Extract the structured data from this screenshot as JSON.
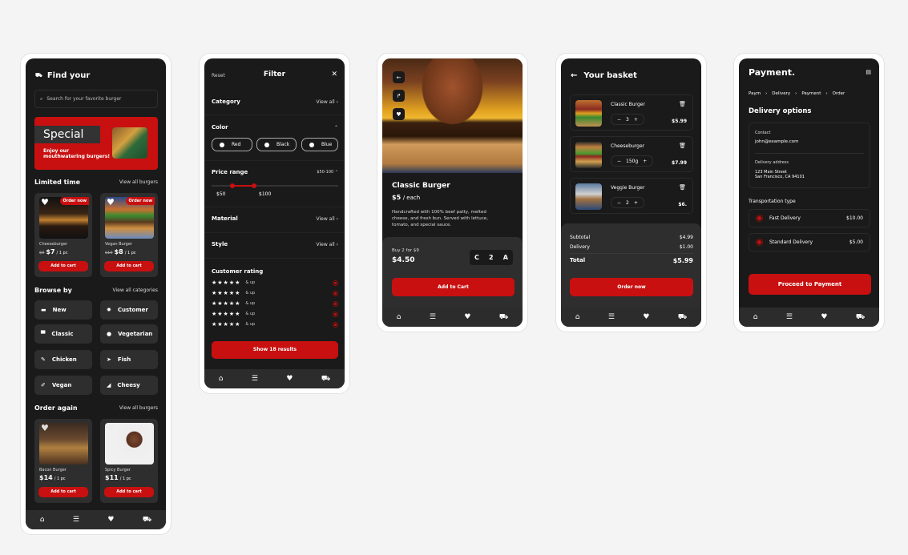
{
  "colors": {
    "accent": "#c81010",
    "background": "#1a1a1a",
    "surface": "#2e2e2e"
  },
  "nav": {
    "items": [
      {
        "name": "home",
        "icon": "⌂"
      },
      {
        "name": "list",
        "icon": "☰"
      },
      {
        "name": "favorites",
        "icon": "♥"
      },
      {
        "name": "basket",
        "icon": "🧺"
      }
    ]
  },
  "home": {
    "title": "Find your",
    "title_icon": "basket-icon",
    "search_placeholder": "Search for your favorite burger",
    "special": {
      "label": "Special",
      "subtitle": "Enjoy our mouthwatering burgers!"
    },
    "limited": {
      "title": "Limited time",
      "link": "View all burgers",
      "items": [
        {
          "name": "Cheeseburger",
          "old_price": "$9",
          "price": "$7",
          "unit": "/ 1 pc",
          "badge": "Order now",
          "button": "Add to cart"
        },
        {
          "name": "Vegan Burger",
          "old_price": "$10",
          "price": "$8",
          "unit": "/ 1 pc",
          "badge": "Order now",
          "button": "Add to cart"
        }
      ]
    },
    "browse": {
      "title": "Browse by",
      "link": "View all categories",
      "items": [
        {
          "label": "New",
          "icon": "▬"
        },
        {
          "label": "Customer",
          "icon": "✹"
        },
        {
          "label": "Classic",
          "icon": "▀"
        },
        {
          "label": "Vegetarian",
          "icon": ""
        },
        {
          "label": "Chicken",
          "icon": "🍗"
        },
        {
          "label": "Fish",
          "icon": "➤"
        },
        {
          "label": "Vegan",
          "icon": "🥕"
        },
        {
          "label": "Cheesy",
          "icon": "◢"
        }
      ]
    },
    "order_again": {
      "title": "Order again",
      "link": "View all burgers",
      "items": [
        {
          "name": "Bacon Burger",
          "price": "$14",
          "unit": "/ 1 pc",
          "button": "Add to cart"
        },
        {
          "name": "Spicy Burger",
          "price": "$11",
          "unit": "/ 1 pc",
          "button": "Add to cart"
        }
      ]
    }
  },
  "filter": {
    "reset": "Reset",
    "title": "Filter",
    "close": "✕",
    "category": {
      "label": "Category",
      "link": "View all"
    },
    "color": {
      "label": "Color",
      "options": [
        "Red",
        "Black",
        "Blue"
      ]
    },
    "price": {
      "label": "Price range",
      "summary": "$50-100",
      "min_label": "$50",
      "max_label": "$100",
      "min": 50,
      "max": 100
    },
    "material": {
      "label": "Material",
      "link": "View all"
    },
    "style": {
      "label": "Style",
      "link": "View all"
    },
    "rating": {
      "label": "Customer rating",
      "rows": [
        {
          "stars": "★★★★★",
          "suffix": "& up"
        },
        {
          "stars": "★★★★★",
          "suffix": "& up"
        },
        {
          "stars": "★★★★★",
          "suffix": "& up"
        },
        {
          "stars": "★★★★★",
          "suffix": "& up"
        },
        {
          "stars": "★★★★★",
          "suffix": "& up"
        }
      ]
    },
    "show_button": "Show 18 results"
  },
  "product": {
    "name": "Classic Burger",
    "price": "$5",
    "unit": "/ each",
    "description": "Handcrafted with 100% beef patty, melted cheese, and fresh bun. Served with lettuce, tomato, and special sauce.",
    "deal": "Buy 2 for $9",
    "deal_price": "$4.50",
    "stepper": {
      "minus": "C",
      "value": "2",
      "plus": "A"
    },
    "button": "Add to Cart"
  },
  "basket": {
    "title": "Your basket",
    "items": [
      {
        "name": "Classic Burger",
        "qty": "3",
        "price": "$5.99"
      },
      {
        "name": "Cheeseburger",
        "qty": "150g",
        "price": "$7.99"
      },
      {
        "name": "Veggie Burger",
        "qty": "2",
        "price": "$6."
      }
    ],
    "subtotal_label": "Subtotal",
    "subtotal": "$4.99",
    "delivery_label": "Delivery",
    "delivery": "$1.00",
    "total_label": "Total",
    "total": "$5.99",
    "button": "Order now"
  },
  "payment": {
    "title": "Payment.",
    "breadcrumb": [
      "Paym",
      "Delivery",
      "Payment",
      "Order"
    ],
    "section": "Delivery options",
    "contact_label": "Contact",
    "contact": "john@example.com",
    "address_label": "Delivery address",
    "address_line1": "123 Main Street",
    "address_line2": "San Francisco, CA 94101",
    "transport_label": "Transportation type",
    "options": [
      {
        "label": "Fast Delivery",
        "price": "$10.00"
      },
      {
        "label": "Standard Delivery",
        "price": "$5.00"
      }
    ],
    "button": "Proceed to Payment"
  }
}
